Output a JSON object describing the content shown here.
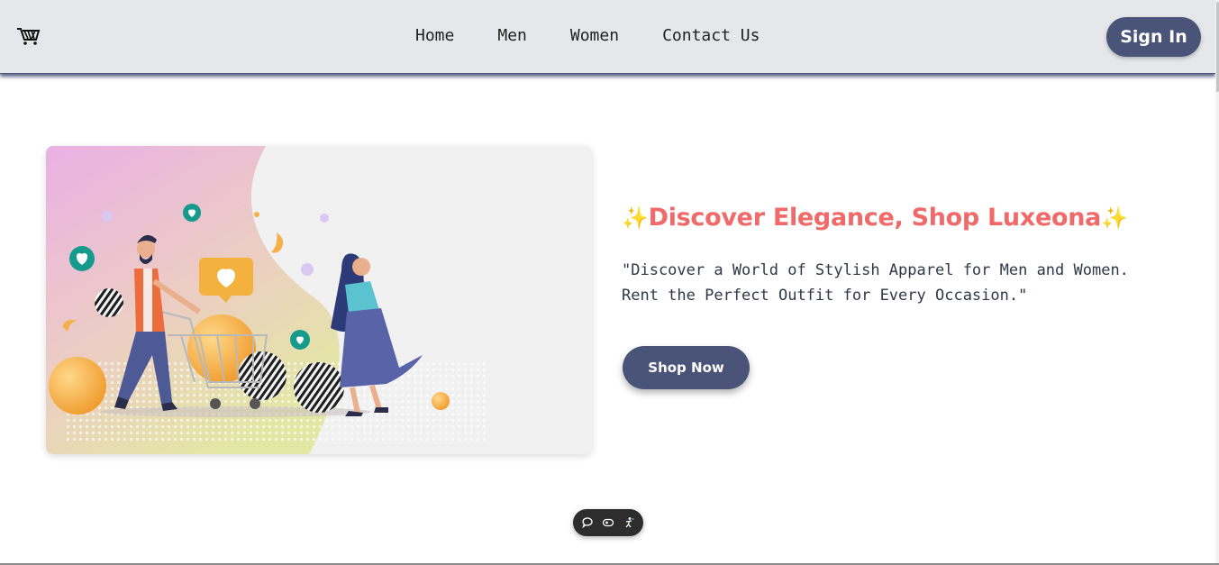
{
  "navbar": {
    "logo_icon": "shopping-cart-logo-icon",
    "links": [
      {
        "label": "Home"
      },
      {
        "label": "Men"
      },
      {
        "label": "Women"
      },
      {
        "label": "Contact Us"
      }
    ],
    "signin_label": "Sign In"
  },
  "hero": {
    "image_description_icon": "shopping-illustration",
    "title_sparkle": "✨",
    "title": "Discover Elegance, Shop Luxeona",
    "description_line1": "\"Discover a World of Stylish Apparel for Men and Women.",
    "description_line2": "Rent the Perfect Outfit for Every Occasion.\"",
    "cta_label": "Shop Now"
  },
  "floating_toolbar": {
    "icons": [
      "chat-icon",
      "eye-icon",
      "accessibility-icon"
    ]
  },
  "colors": {
    "navbar_bg": "#e6e7ea",
    "button_bg": "#4a5478",
    "title_color": "#f06a6a",
    "text_color": "#2f3848"
  }
}
